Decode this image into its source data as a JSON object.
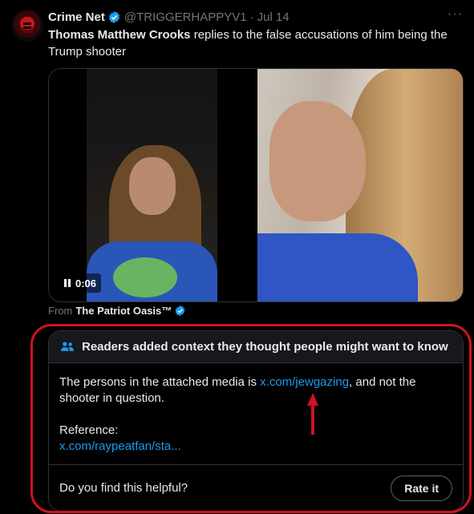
{
  "tweet": {
    "author_name": "Crime Net",
    "author_handle": "@TRIGGERHAPPYV1",
    "separator": "·",
    "date": "Jul 14",
    "more_label": "···",
    "text_bold": "Thomas Matthew Crooks",
    "text_rest": " replies to the false accusations of him being the Trump shooter",
    "video_time": "0:06",
    "from_prefix": "From",
    "from_source": "The Patriot Oasis™"
  },
  "community_note": {
    "header": "Readers added context they thought people might want to know",
    "body_prefix": "The persons in the attached media is ",
    "body_link": "x.com/jewgazing",
    "body_suffix": ", and not the shooter in question.",
    "reference_label": "Reference:",
    "reference_link": "x.com/raypeatfan/sta...",
    "helpful_question": "Do you find this helpful?",
    "rate_button": "Rate it"
  },
  "colors": {
    "background": "#000000",
    "link": "#1d9bf0",
    "verified": "#1d9bf0",
    "annotation": "#d11222",
    "muted": "#71767b"
  },
  "icons": [
    "verified-badge-icon",
    "more-icon",
    "pause-icon",
    "people-icon",
    "arrow-up-icon"
  ]
}
